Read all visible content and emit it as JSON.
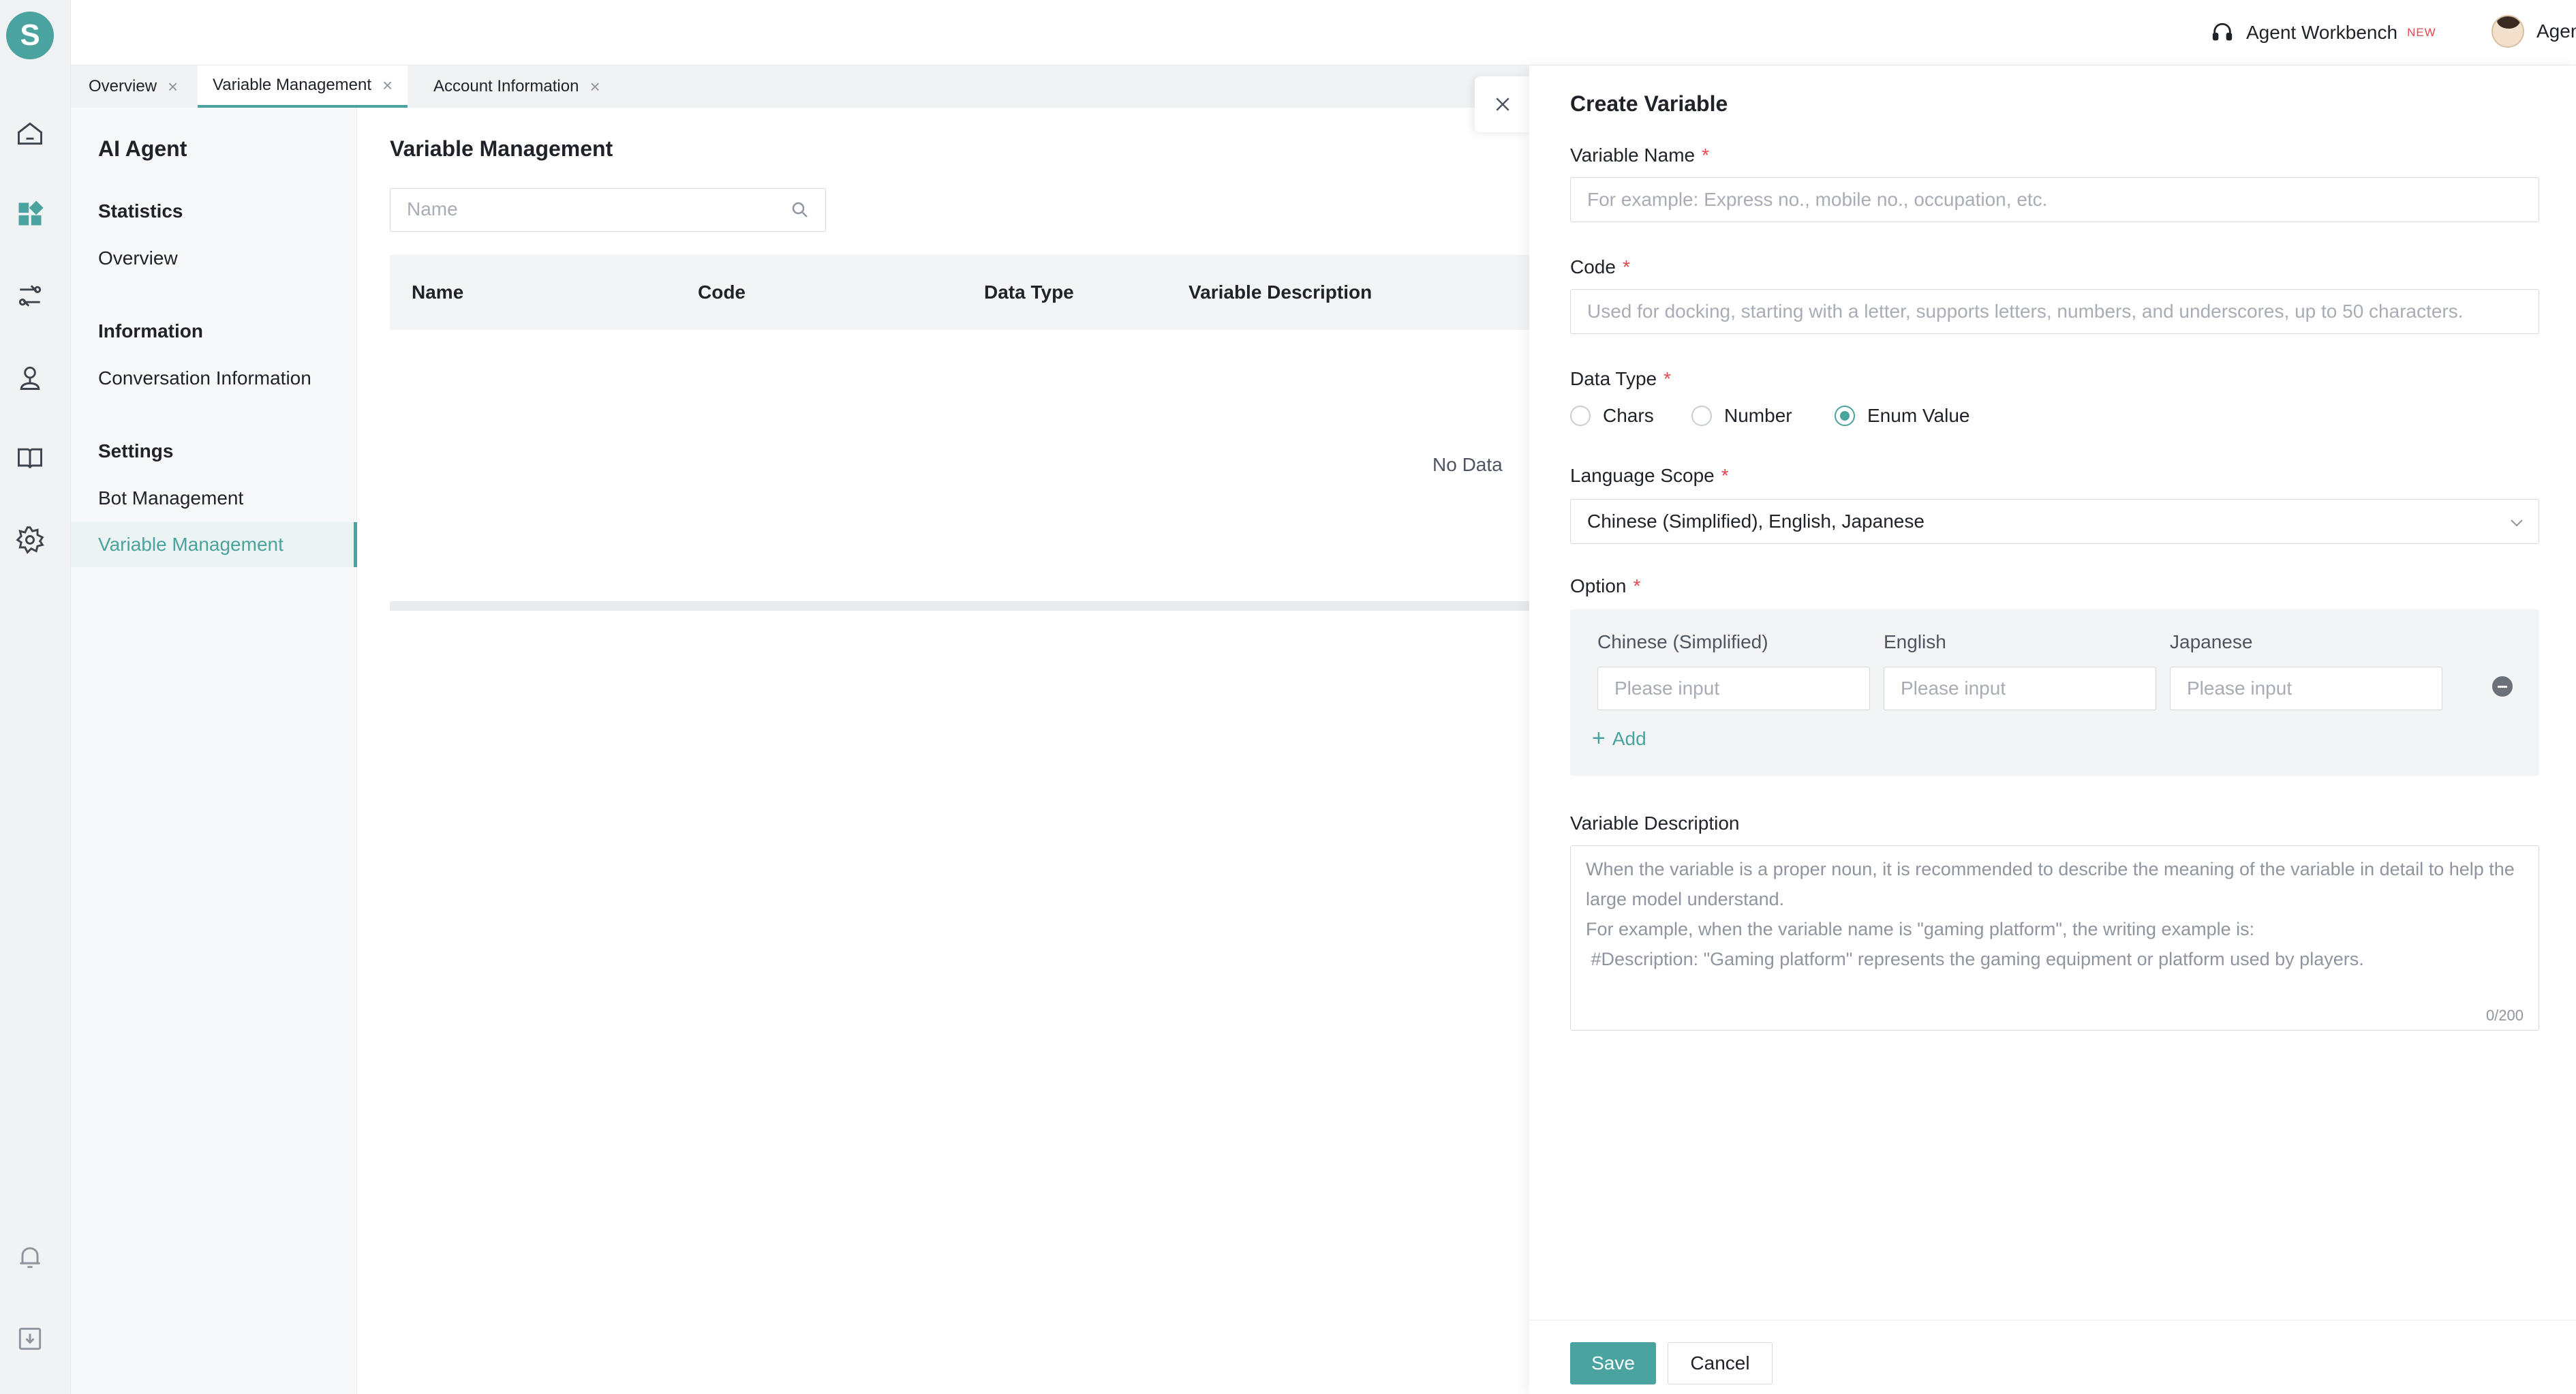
{
  "topbar": {
    "workbench_label": "Agent Workbench",
    "new_badge": "NEW",
    "user_name": "Agent"
  },
  "logo_letter": "S",
  "tabs": [
    {
      "label": "Overview",
      "close": "×"
    },
    {
      "label": "Variable Management",
      "close": "×"
    },
    {
      "label": "Account Information",
      "close": "×"
    }
  ],
  "subnav": {
    "title": "AI Agent",
    "groups": [
      {
        "title": "Statistics",
        "items": [
          "Overview"
        ]
      },
      {
        "title": "Information",
        "items": [
          "Conversation Information"
        ]
      },
      {
        "title": "Settings",
        "items": [
          "Bot Management",
          "Variable Management"
        ]
      }
    ]
  },
  "main": {
    "title": "Variable Management",
    "search_placeholder": "Name",
    "columns": [
      "Name",
      "Code",
      "Data Type",
      "Variable Description"
    ],
    "empty_text": "No Data"
  },
  "drawer": {
    "title": "Create Variable",
    "required_mark": "*",
    "variable_name": {
      "label": "Variable Name",
      "placeholder": "For example: Express no., mobile no., occupation, etc.",
      "value": ""
    },
    "code": {
      "label": "Code",
      "placeholder": "Used for docking, starting with a letter, supports letters, numbers, and underscores, up to 50 characters.",
      "value": ""
    },
    "data_type": {
      "label": "Data Type",
      "options": [
        "Chars",
        "Number",
        "Enum Value"
      ],
      "selected": "Enum Value"
    },
    "language_scope": {
      "label": "Language Scope",
      "value": "Chinese (Simplified), English, Japanese"
    },
    "option": {
      "label": "Option",
      "columns": [
        "Chinese (Simplified)",
        "English",
        "Japanese"
      ],
      "input_placeholder": "Please input",
      "add_label": "Add"
    },
    "description": {
      "label": "Variable Description",
      "placeholder": "When the variable is a proper noun, it is recommended to describe the meaning of the variable in detail to help the large model understand.\nFor example, when the variable name is \"gaming platform\", the writing example is:\n #Description: \"Gaming platform\" represents the gaming equipment or platform used by players.",
      "counter": "0/200"
    },
    "save_label": "Save",
    "cancel_label": "Cancel"
  },
  "colors": {
    "accent": "#4aa39e",
    "required": "#e5484d"
  }
}
